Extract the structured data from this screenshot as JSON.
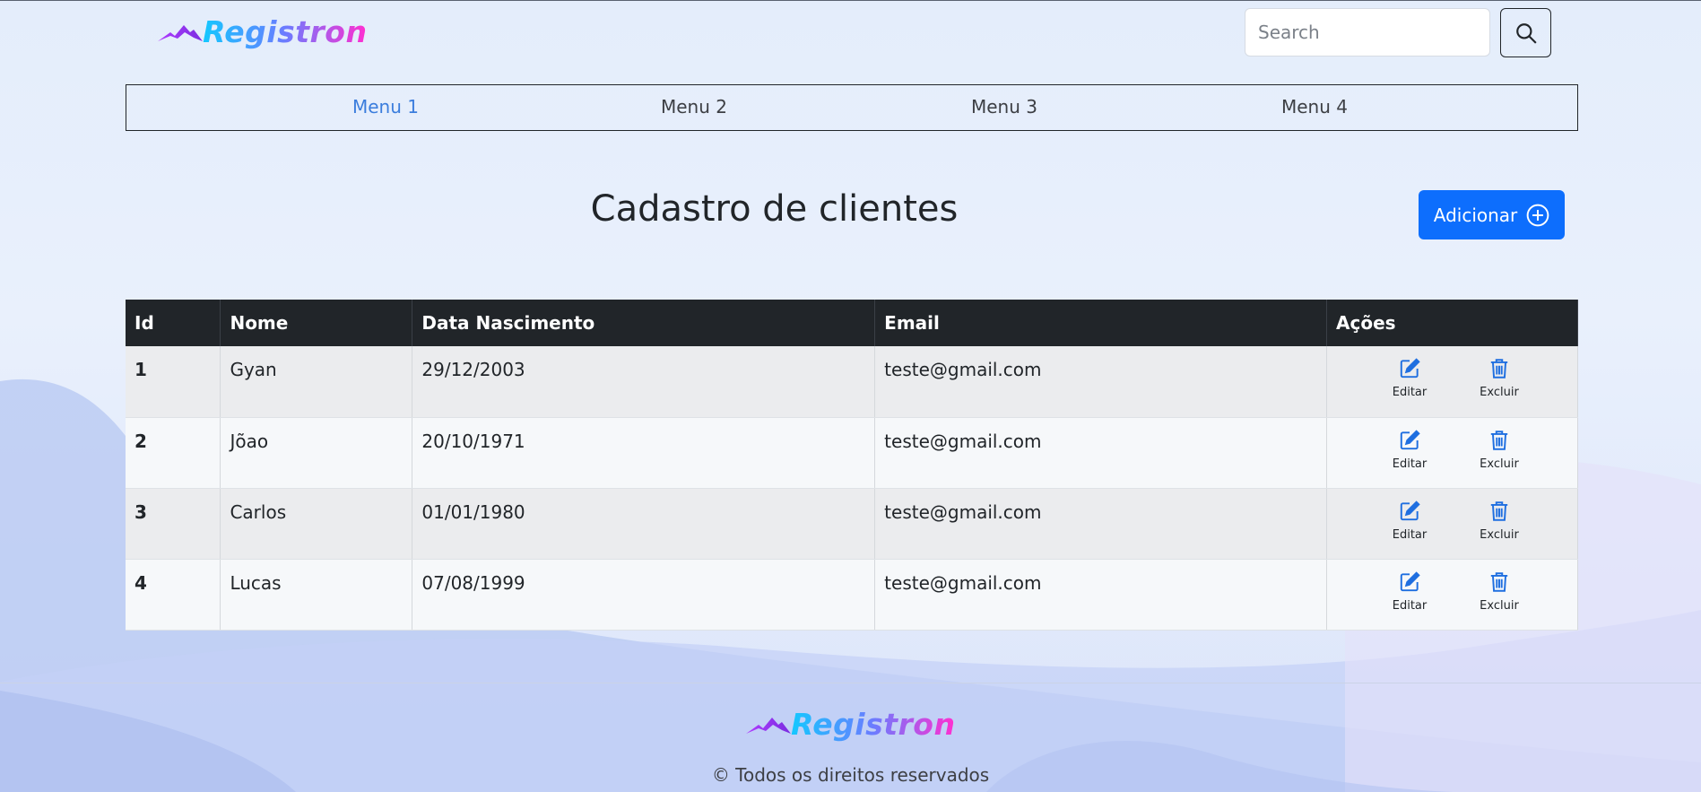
{
  "brand": {
    "name": "Registron",
    "logo_icon": "mountain-icon"
  },
  "search": {
    "placeholder": "Search",
    "value": "",
    "button_icon": "search-icon"
  },
  "nav": {
    "items": [
      {
        "label": "Menu 1",
        "active": true
      },
      {
        "label": "Menu 2",
        "active": false
      },
      {
        "label": "Menu 3",
        "active": false
      },
      {
        "label": "Menu 4",
        "active": false
      }
    ]
  },
  "page": {
    "title": "Cadastro de clientes",
    "add_button": {
      "label": "Adicionar",
      "icon": "plus-circle-icon"
    }
  },
  "table": {
    "headers": [
      "Id",
      "Nome",
      "Data Nascimento",
      "Email",
      "Ações"
    ],
    "rows": [
      {
        "id": "1",
        "nome": "Gyan",
        "nascimento": "29/12/2003",
        "email": "teste@gmail.com"
      },
      {
        "id": "2",
        "nome": "Jõao",
        "nascimento": "20/10/1971",
        "email": "teste@gmail.com"
      },
      {
        "id": "3",
        "nome": "Carlos",
        "nascimento": "01/01/1980",
        "email": "teste@gmail.com"
      },
      {
        "id": "4",
        "nome": "Lucas",
        "nascimento": "07/08/1999",
        "email": "teste@gmail.com"
      }
    ],
    "actions": {
      "edit_label": "Editar",
      "delete_label": "Excluir",
      "edit_icon": "edit-icon",
      "delete_icon": "trash-icon"
    }
  },
  "footer": {
    "brand": "Registron",
    "copyright": "© Todos os direitos reservados"
  },
  "colors": {
    "primary": "#0d6efd",
    "nav_active": "#3b7ddd",
    "table_header": "#212529",
    "action_icon": "#1f6fe0"
  }
}
